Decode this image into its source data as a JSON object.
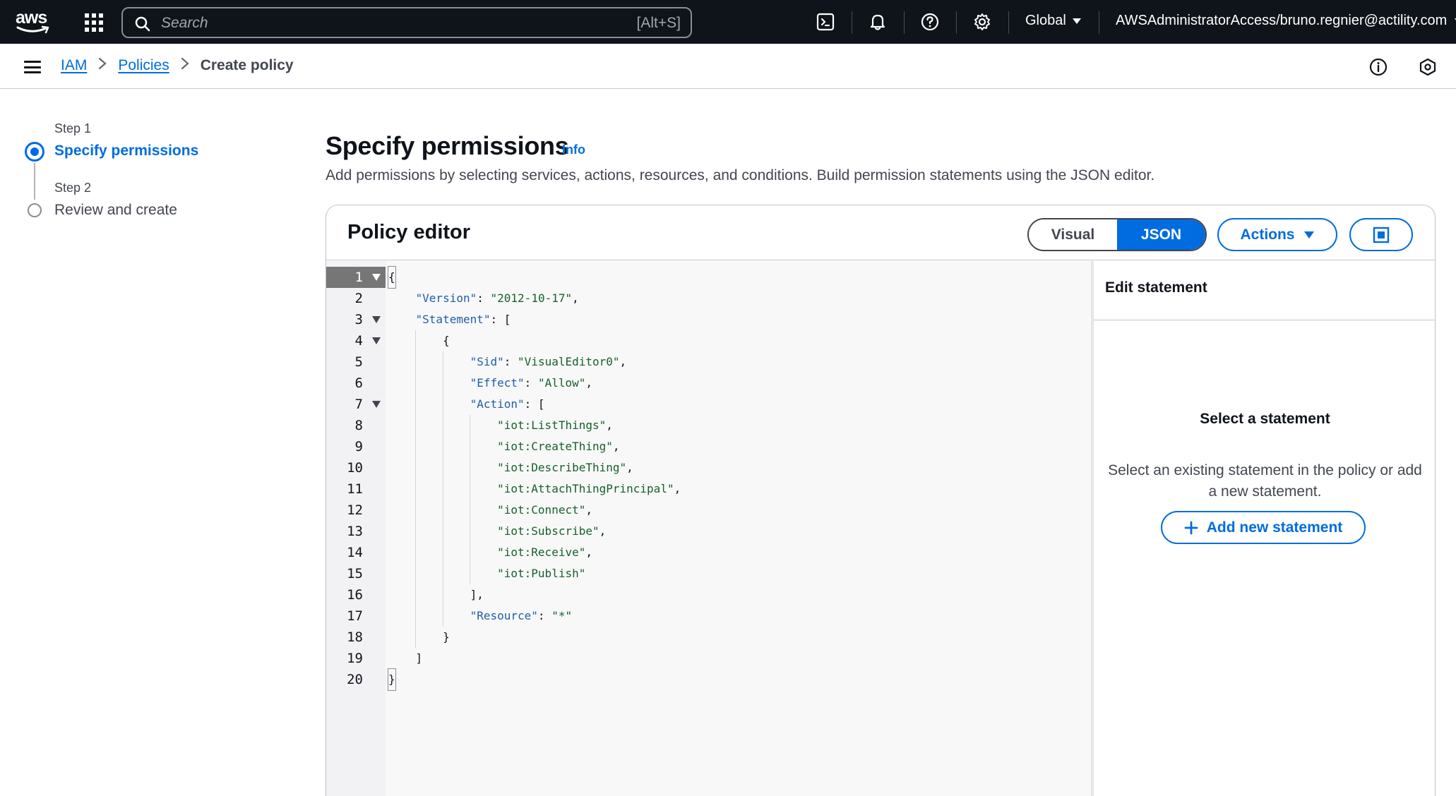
{
  "topnav": {
    "logo_text": "aws",
    "search_placeholder": "Search",
    "search_shortcut": "[Alt+S]",
    "region": "Global",
    "account": "AWSAdministratorAccess/bruno.regnier@actility.com",
    "icons": [
      "grid-icon",
      "cloudshell-icon",
      "bell-icon",
      "help-icon",
      "gear-icon"
    ]
  },
  "breadcrumb": {
    "items": [
      {
        "label": "IAM"
      },
      {
        "label": "Policies"
      },
      {
        "label": "Create policy"
      }
    ]
  },
  "wizard": {
    "steps": [
      {
        "step": "Step 1",
        "title": "Specify permissions",
        "active": true
      },
      {
        "step": "Step 2",
        "title": "Review and create",
        "active": false
      }
    ]
  },
  "header": {
    "title": "Specify permissions",
    "info": "Info",
    "description": "Add permissions by selecting services, actions, resources, and conditions. Build permission statements using the JSON editor."
  },
  "editor": {
    "title": "Policy editor",
    "mode_visual": "Visual",
    "mode_json": "JSON",
    "selected_mode": "JSON",
    "actions_label": "Actions",
    "current_line": 1,
    "lines": [
      "{",
      "    \"Version\": \"2012-10-17\",",
      "    \"Statement\": [",
      "        {",
      "            \"Sid\": \"VisualEditor0\",",
      "            \"Effect\": \"Allow\",",
      "            \"Action\": [",
      "                \"iot:ListThings\",",
      "                \"iot:CreateThing\",",
      "                \"iot:DescribeThing\",",
      "                \"iot:AttachThingPrincipal\",",
      "                \"iot:Connect\",",
      "                \"iot:Subscribe\",",
      "                \"iot:Receive\",",
      "                \"iot:Publish\"",
      "            ],",
      "            \"Resource\": \"*\"",
      "        }",
      "    ]",
      "}"
    ],
    "foldable_lines": [
      1,
      3,
      4,
      7
    ]
  },
  "statement_panel": {
    "title": "Edit statement",
    "empty_title": "Select a statement",
    "empty_description": "Select an existing statement in the policy or add a new statement.",
    "add_button": "Add new statement"
  },
  "colors": {
    "accent": "#006ce0",
    "nav_bg": "#0f141a",
    "key": "#1f5ea8",
    "string": "#166129"
  }
}
